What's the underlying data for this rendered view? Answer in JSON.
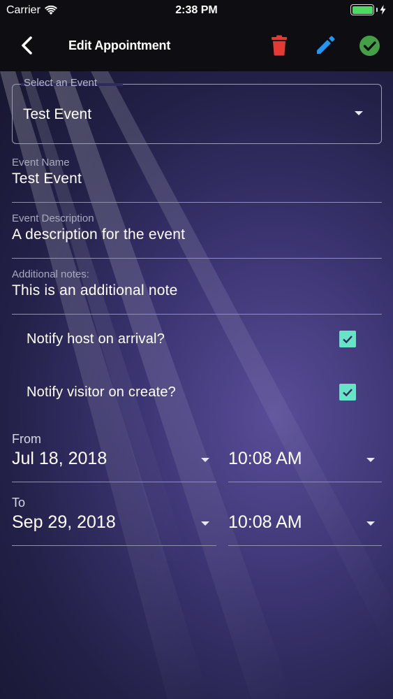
{
  "status_bar": {
    "carrier": "Carrier",
    "time": "2:38 PM",
    "battery_color": "#4cd964"
  },
  "nav": {
    "back_icon": "chevron-left-icon",
    "title": "Edit Appointment",
    "delete_icon": "trash-icon",
    "edit_icon": "pencil-icon",
    "save_icon": "check-circle-icon",
    "delete_color": "#e53935",
    "edit_color": "#2196f3",
    "save_color": "#43a047"
  },
  "form": {
    "event_select": {
      "label": "Select an Event",
      "value": "Test Event"
    },
    "event_name": {
      "label": "Event Name",
      "value": "Test Event"
    },
    "event_description": {
      "label": "Event Description",
      "value": "A description for the event"
    },
    "additional_notes": {
      "label": "Additional notes:",
      "value": "This is an additional note"
    },
    "notify_host": {
      "label": "Notify host on arrival?",
      "checked": true
    },
    "notify_visitor": {
      "label": "Notify visitor on create?",
      "checked": true
    },
    "from": {
      "label": "From",
      "date": "Jul 18, 2018",
      "time": "10:08 AM"
    },
    "to": {
      "label": "To",
      "date": "Sep 29, 2018",
      "time": "10:08 AM"
    },
    "checkbox_color": "#69e3c7"
  }
}
